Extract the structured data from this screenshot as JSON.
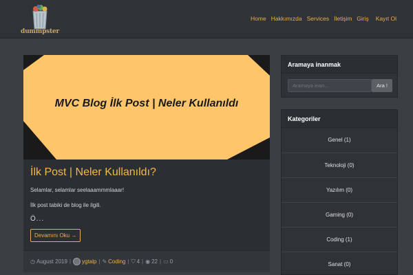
{
  "brand": {
    "logo_text": "dummpster",
    "logo_icon": "trash-can-icon"
  },
  "nav": {
    "links": [
      "Home",
      "Hakkımızda",
      "Services",
      "İletişim"
    ],
    "right": [
      "Giriş",
      "Kayıt Ol"
    ]
  },
  "post": {
    "hero_title": "MVC Blog İlk Post | Neler Kullanıldı",
    "title": "İlk Post | Neler Kullanıldı?",
    "lines": [
      "Selamlar, selamlar seelaaammmlaaar!",
      "İlk post tabiki de blog ile ilgili."
    ],
    "ellipsis": "Ö...",
    "read_more": "Devamını Oku →",
    "meta": {
      "date": "August 2019",
      "author": "ygtalp",
      "category": "Coding",
      "tags": "4",
      "views": "22",
      "comments": "0"
    }
  },
  "search_widget": {
    "title": "Aramaya inanmak",
    "placeholder": "Aramaya inan...",
    "button": "Ara !"
  },
  "categories_widget": {
    "title": "Kategoriler",
    "items": [
      "Genel (1)",
      "Teknoloji (0)",
      "Yazılım (0)",
      "Gaming (0)",
      "Coding (1)",
      "Sanat (0)"
    ]
  },
  "colors": {
    "accent": "#e8b04a",
    "hero_bg": "#ffc56a",
    "page_bg": "#3a3f44"
  }
}
